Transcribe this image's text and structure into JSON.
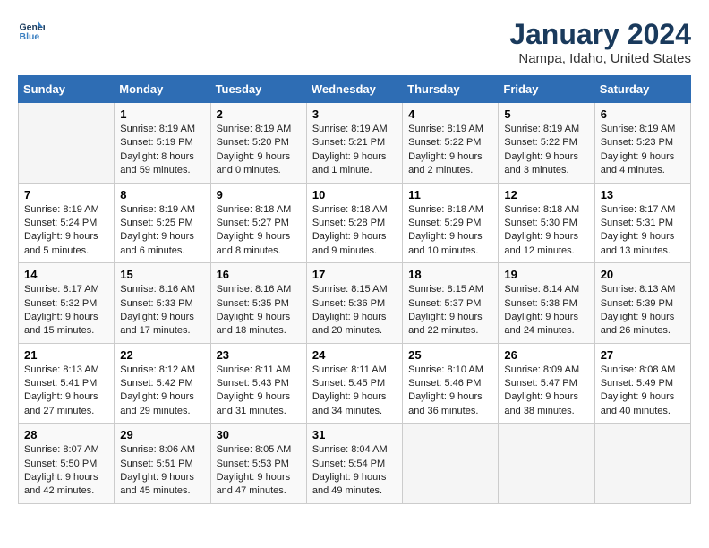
{
  "header": {
    "logo_line1": "General",
    "logo_line2": "Blue",
    "month": "January 2024",
    "location": "Nampa, Idaho, United States"
  },
  "weekdays": [
    "Sunday",
    "Monday",
    "Tuesday",
    "Wednesday",
    "Thursday",
    "Friday",
    "Saturday"
  ],
  "weeks": [
    [
      {
        "day": "",
        "info": ""
      },
      {
        "day": "1",
        "info": "Sunrise: 8:19 AM\nSunset: 5:19 PM\nDaylight: 8 hours\nand 59 minutes."
      },
      {
        "day": "2",
        "info": "Sunrise: 8:19 AM\nSunset: 5:20 PM\nDaylight: 9 hours\nand 0 minutes."
      },
      {
        "day": "3",
        "info": "Sunrise: 8:19 AM\nSunset: 5:21 PM\nDaylight: 9 hours\nand 1 minute."
      },
      {
        "day": "4",
        "info": "Sunrise: 8:19 AM\nSunset: 5:22 PM\nDaylight: 9 hours\nand 2 minutes."
      },
      {
        "day": "5",
        "info": "Sunrise: 8:19 AM\nSunset: 5:22 PM\nDaylight: 9 hours\nand 3 minutes."
      },
      {
        "day": "6",
        "info": "Sunrise: 8:19 AM\nSunset: 5:23 PM\nDaylight: 9 hours\nand 4 minutes."
      }
    ],
    [
      {
        "day": "7",
        "info": "Sunrise: 8:19 AM\nSunset: 5:24 PM\nDaylight: 9 hours\nand 5 minutes."
      },
      {
        "day": "8",
        "info": "Sunrise: 8:19 AM\nSunset: 5:25 PM\nDaylight: 9 hours\nand 6 minutes."
      },
      {
        "day": "9",
        "info": "Sunrise: 8:18 AM\nSunset: 5:27 PM\nDaylight: 9 hours\nand 8 minutes."
      },
      {
        "day": "10",
        "info": "Sunrise: 8:18 AM\nSunset: 5:28 PM\nDaylight: 9 hours\nand 9 minutes."
      },
      {
        "day": "11",
        "info": "Sunrise: 8:18 AM\nSunset: 5:29 PM\nDaylight: 9 hours\nand 10 minutes."
      },
      {
        "day": "12",
        "info": "Sunrise: 8:18 AM\nSunset: 5:30 PM\nDaylight: 9 hours\nand 12 minutes."
      },
      {
        "day": "13",
        "info": "Sunrise: 8:17 AM\nSunset: 5:31 PM\nDaylight: 9 hours\nand 13 minutes."
      }
    ],
    [
      {
        "day": "14",
        "info": "Sunrise: 8:17 AM\nSunset: 5:32 PM\nDaylight: 9 hours\nand 15 minutes."
      },
      {
        "day": "15",
        "info": "Sunrise: 8:16 AM\nSunset: 5:33 PM\nDaylight: 9 hours\nand 17 minutes."
      },
      {
        "day": "16",
        "info": "Sunrise: 8:16 AM\nSunset: 5:35 PM\nDaylight: 9 hours\nand 18 minutes."
      },
      {
        "day": "17",
        "info": "Sunrise: 8:15 AM\nSunset: 5:36 PM\nDaylight: 9 hours\nand 20 minutes."
      },
      {
        "day": "18",
        "info": "Sunrise: 8:15 AM\nSunset: 5:37 PM\nDaylight: 9 hours\nand 22 minutes."
      },
      {
        "day": "19",
        "info": "Sunrise: 8:14 AM\nSunset: 5:38 PM\nDaylight: 9 hours\nand 24 minutes."
      },
      {
        "day": "20",
        "info": "Sunrise: 8:13 AM\nSunset: 5:39 PM\nDaylight: 9 hours\nand 26 minutes."
      }
    ],
    [
      {
        "day": "21",
        "info": "Sunrise: 8:13 AM\nSunset: 5:41 PM\nDaylight: 9 hours\nand 27 minutes."
      },
      {
        "day": "22",
        "info": "Sunrise: 8:12 AM\nSunset: 5:42 PM\nDaylight: 9 hours\nand 29 minutes."
      },
      {
        "day": "23",
        "info": "Sunrise: 8:11 AM\nSunset: 5:43 PM\nDaylight: 9 hours\nand 31 minutes."
      },
      {
        "day": "24",
        "info": "Sunrise: 8:11 AM\nSunset: 5:45 PM\nDaylight: 9 hours\nand 34 minutes."
      },
      {
        "day": "25",
        "info": "Sunrise: 8:10 AM\nSunset: 5:46 PM\nDaylight: 9 hours\nand 36 minutes."
      },
      {
        "day": "26",
        "info": "Sunrise: 8:09 AM\nSunset: 5:47 PM\nDaylight: 9 hours\nand 38 minutes."
      },
      {
        "day": "27",
        "info": "Sunrise: 8:08 AM\nSunset: 5:49 PM\nDaylight: 9 hours\nand 40 minutes."
      }
    ],
    [
      {
        "day": "28",
        "info": "Sunrise: 8:07 AM\nSunset: 5:50 PM\nDaylight: 9 hours\nand 42 minutes."
      },
      {
        "day": "29",
        "info": "Sunrise: 8:06 AM\nSunset: 5:51 PM\nDaylight: 9 hours\nand 45 minutes."
      },
      {
        "day": "30",
        "info": "Sunrise: 8:05 AM\nSunset: 5:53 PM\nDaylight: 9 hours\nand 47 minutes."
      },
      {
        "day": "31",
        "info": "Sunrise: 8:04 AM\nSunset: 5:54 PM\nDaylight: 9 hours\nand 49 minutes."
      },
      {
        "day": "",
        "info": ""
      },
      {
        "day": "",
        "info": ""
      },
      {
        "day": "",
        "info": ""
      }
    ]
  ]
}
